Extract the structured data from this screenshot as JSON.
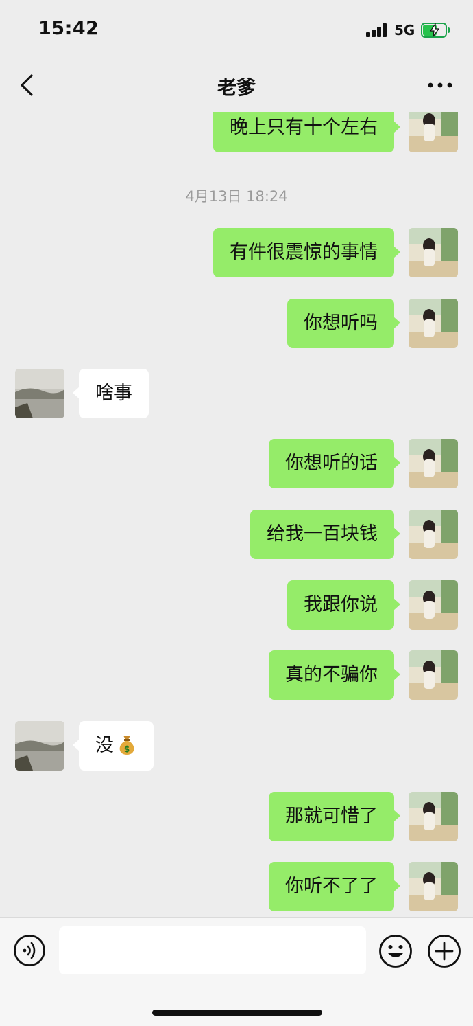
{
  "status_bar": {
    "time": "15:42",
    "network": "5G"
  },
  "nav": {
    "title": "老爹"
  },
  "messages": [
    {
      "sender": "me",
      "text": "晚上只有十个左右"
    },
    {
      "type": "timestamp",
      "text": "4月13日 18:24"
    },
    {
      "sender": "me",
      "text": "有件很震惊的事情"
    },
    {
      "sender": "me",
      "text": "你想听吗"
    },
    {
      "sender": "other",
      "text": "啥事"
    },
    {
      "sender": "me",
      "text": "你想听的话"
    },
    {
      "sender": "me",
      "text": "给我一百块钱"
    },
    {
      "sender": "me",
      "text": "我跟你说"
    },
    {
      "sender": "me",
      "text": "真的不骗你"
    },
    {
      "sender": "other",
      "text": "没",
      "emoji": "money-bag"
    },
    {
      "sender": "me",
      "text": "那就可惜了"
    },
    {
      "sender": "me",
      "text": "你听不了了"
    }
  ],
  "input_bar": {
    "placeholder": ""
  },
  "colors": {
    "my_bubble": "#95ec69",
    "their_bubble": "#ffffff",
    "background": "#ededed"
  }
}
